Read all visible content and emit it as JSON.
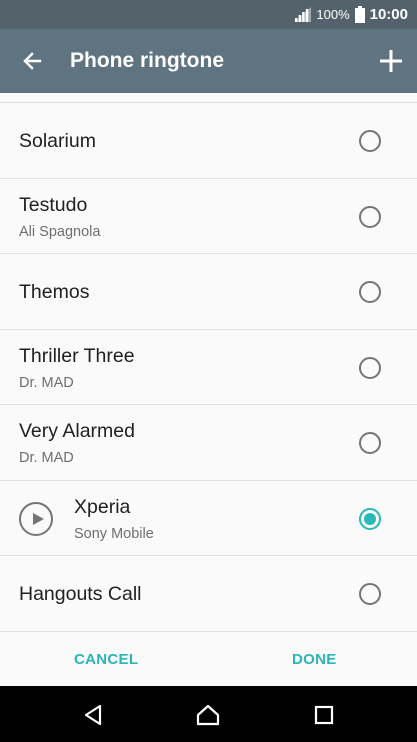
{
  "status_bar": {
    "battery_text": "100%",
    "time": "10:00"
  },
  "app_bar": {
    "title": "Phone ringtone",
    "back_icon": "arrow-back-icon",
    "add_icon": "plus-icon"
  },
  "ringtones": [
    {
      "title": "Solarium",
      "subtitle": "",
      "selected": false
    },
    {
      "title": "Testudo",
      "subtitle": "Ali Spagnola",
      "selected": false
    },
    {
      "title": "Themos",
      "subtitle": "",
      "selected": false
    },
    {
      "title": "Thriller Three",
      "subtitle": "Dr. MAD",
      "selected": false
    },
    {
      "title": "Very Alarmed",
      "subtitle": "Dr. MAD",
      "selected": false
    },
    {
      "title": "Xperia",
      "subtitle": "Sony Mobile",
      "selected": true,
      "playing_control": "play-circle-icon"
    },
    {
      "title": "Hangouts Call",
      "subtitle": "",
      "selected": false
    }
  ],
  "actions": {
    "cancel": "CANCEL",
    "done": "DONE"
  },
  "colors": {
    "status_bar": "#54626c",
    "app_bar": "#607380",
    "accent": "#28b9b9",
    "nav_bar": "#000000"
  }
}
